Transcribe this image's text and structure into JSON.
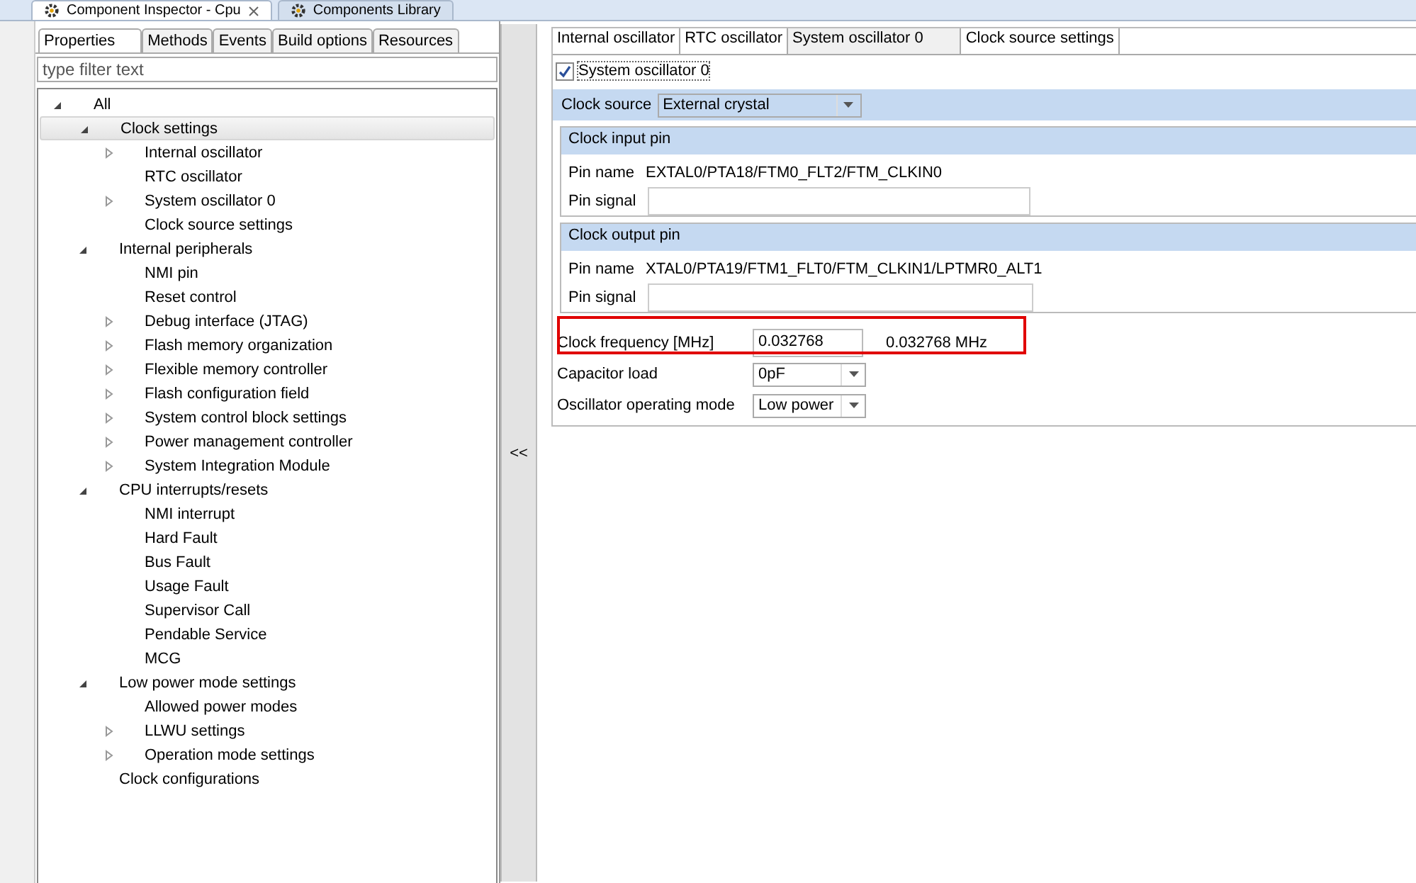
{
  "editor_tabs": [
    {
      "label": "Component Inspector - Cpu",
      "selected": true,
      "closable": true
    },
    {
      "label": "Components Library",
      "selected": false,
      "closable": false
    }
  ],
  "view_tabs": [
    {
      "label": "Properties",
      "selected": true
    },
    {
      "label": "Methods",
      "selected": false
    },
    {
      "label": "Events",
      "selected": false
    },
    {
      "label": "Build options",
      "selected": false
    },
    {
      "label": "Resources",
      "selected": false
    }
  ],
  "filter": {
    "placeholder": "type filter text"
  },
  "tree": [
    {
      "label": "All",
      "kind": "expanded",
      "selected": false,
      "children": [
        {
          "label": "Clock settings",
          "kind": "expanded",
          "selected": true,
          "children": [
            {
              "label": "Internal oscillator",
              "kind": "collapsed",
              "selected": false
            },
            {
              "label": "RTC oscillator",
              "kind": "leaf",
              "selected": false
            },
            {
              "label": "System oscillator 0",
              "kind": "collapsed",
              "selected": false
            },
            {
              "label": "Clock source settings",
              "kind": "leaf",
              "selected": false
            }
          ]
        },
        {
          "label": "Internal peripherals",
          "kind": "expanded",
          "selected": false,
          "children": [
            {
              "label": "NMI pin",
              "kind": "leaf",
              "selected": false
            },
            {
              "label": "Reset control",
              "kind": "leaf",
              "selected": false
            },
            {
              "label": "Debug interface (JTAG)",
              "kind": "collapsed",
              "selected": false
            },
            {
              "label": "Flash memory organization",
              "kind": "collapsed",
              "selected": false
            },
            {
              "label": "Flexible memory controller",
              "kind": "collapsed",
              "selected": false
            },
            {
              "label": "Flash configuration field",
              "kind": "collapsed",
              "selected": false
            },
            {
              "label": "System control block settings",
              "kind": "collapsed",
              "selected": false
            },
            {
              "label": "Power management controller",
              "kind": "collapsed",
              "selected": false
            },
            {
              "label": "System Integration Module",
              "kind": "collapsed",
              "selected": false
            }
          ]
        },
        {
          "label": "CPU interrupts/resets",
          "kind": "expanded",
          "selected": false,
          "children": [
            {
              "label": "NMI interrupt",
              "kind": "leaf",
              "selected": false
            },
            {
              "label": "Hard Fault",
              "kind": "leaf",
              "selected": false
            },
            {
              "label": "Bus Fault",
              "kind": "leaf",
              "selected": false
            },
            {
              "label": "Usage Fault",
              "kind": "leaf",
              "selected": false
            },
            {
              "label": "Supervisor Call",
              "kind": "leaf",
              "selected": false
            },
            {
              "label": "Pendable Service",
              "kind": "leaf",
              "selected": false
            },
            {
              "label": "MCG",
              "kind": "leaf",
              "selected": false
            }
          ]
        },
        {
          "label": "Low power mode settings",
          "kind": "expanded",
          "selected": false,
          "children": [
            {
              "label": "Allowed power modes",
              "kind": "leaf",
              "selected": false
            },
            {
              "label": "LLWU settings",
              "kind": "collapsed",
              "selected": false
            },
            {
              "label": "Operation mode settings",
              "kind": "collapsed",
              "selected": false
            }
          ]
        },
        {
          "label": "Clock configurations",
          "kind": "leaf",
          "selected": false
        }
      ]
    }
  ],
  "collapse_button": "<<",
  "detail_tabs": [
    {
      "label": "Internal oscillator",
      "selected": false
    },
    {
      "label": "RTC oscillator",
      "selected": false
    },
    {
      "label": "System oscillator 0",
      "selected": true
    },
    {
      "label": "Clock source settings",
      "selected": false
    }
  ],
  "enable": {
    "label": "System oscillator 0",
    "checked": true
  },
  "clock_source": {
    "label": "Clock source",
    "value": "External crystal"
  },
  "groups": [
    {
      "title": "Clock input pin",
      "pin_name_label": "Pin name",
      "pin_name": "EXTAL0/PTA18/FTM0_FLT2/FTM_CLKIN0",
      "pin_signal_label": "Pin signal"
    },
    {
      "title": "Clock output pin",
      "pin_name_label": "Pin name",
      "pin_name": "XTAL0/PTA19/FTM1_FLT0/FTM_CLKIN1/LPTMR0_ALT1",
      "pin_signal_label": "Pin signal"
    }
  ],
  "settings": [
    {
      "kind": "input",
      "label": "Clock frequency [MHz]",
      "value": "0.032768",
      "reading": "0.032768 MHz",
      "highlighted": true
    },
    {
      "kind": "dropdown",
      "label": "Capacitor load",
      "value": "0pF",
      "highlighted": false
    },
    {
      "kind": "dropdown",
      "label": "Oscillator operating mode",
      "value": "Low power",
      "highlighted": false
    }
  ]
}
